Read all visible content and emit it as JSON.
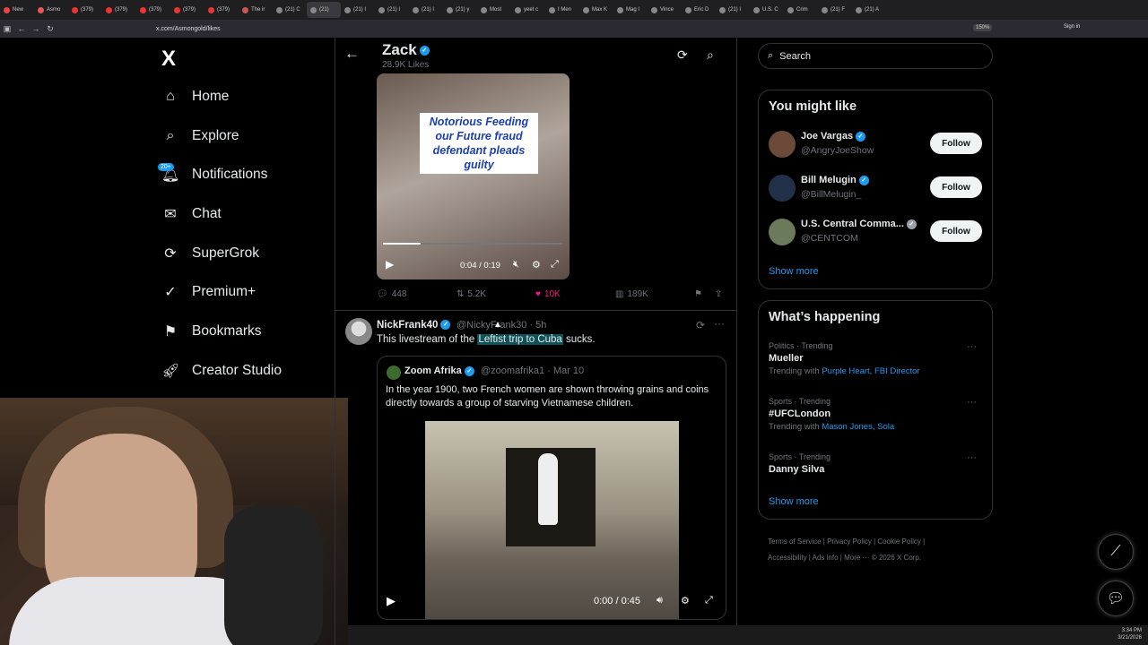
{
  "browser": {
    "tabs": [
      {
        "label": "New",
        "color": "#e44"
      },
      {
        "label": "Asmo",
        "color": "#e55"
      },
      {
        "label": "(379)",
        "color": "#e33"
      },
      {
        "label": "(379)",
        "color": "#e33"
      },
      {
        "label": "(379)",
        "color": "#e33"
      },
      {
        "label": "(379)",
        "color": "#e33"
      },
      {
        "label": "(379)",
        "color": "#e33"
      },
      {
        "label": "The ir",
        "color": "#c55"
      },
      {
        "label": "(21) C",
        "color": "#888"
      },
      {
        "label": "(21)",
        "color": "#888"
      },
      {
        "label": "(21) I",
        "color": "#888"
      },
      {
        "label": "(21) I",
        "color": "#888"
      },
      {
        "label": "(21) I",
        "color": "#888"
      },
      {
        "label": "(21) y",
        "color": "#888"
      },
      {
        "label": "Most",
        "color": "#888"
      },
      {
        "label": "yeet c",
        "color": "#888"
      },
      {
        "label": "I Men",
        "color": "#888"
      },
      {
        "label": "Max K",
        "color": "#888"
      },
      {
        "label": "Mag I",
        "color": "#888"
      },
      {
        "label": "Vince",
        "color": "#888"
      },
      {
        "label": "Eric D",
        "color": "#888"
      },
      {
        "label": "(21) I",
        "color": "#888"
      },
      {
        "label": "U.S. C",
        "color": "#888"
      },
      {
        "label": "Crim",
        "color": "#888"
      },
      {
        "label": "(21) F",
        "color": "#888"
      },
      {
        "label": "(21) A",
        "color": "#888"
      }
    ],
    "url": "x.com/Asmongold/likes",
    "zoom": "150%",
    "sign_in": "Sign in"
  },
  "nav": {
    "logo": "X",
    "items": [
      {
        "label": "Home",
        "icon": "home-icon"
      },
      {
        "label": "Explore",
        "icon": "search-icon"
      },
      {
        "label": "Notifications",
        "icon": "bell-icon",
        "badge": "20+"
      },
      {
        "label": "Chat",
        "icon": "mail-icon"
      },
      {
        "label": "SuperGrok",
        "icon": "grok-icon"
      },
      {
        "label": "Premium+",
        "icon": "verified-icon"
      },
      {
        "label": "Bookmarks",
        "icon": "bookmark-icon"
      },
      {
        "label": "Creator Studio",
        "icon": "rocket-icon"
      }
    ]
  },
  "profile_header": {
    "name": "Zack",
    "subtitle": "28.9K Likes"
  },
  "tweet1": {
    "video_caption": "Notorious Feeding our Future fraud defendant pleads guilty",
    "video_time": "0:04 / 0:19",
    "video_progress": 0.21,
    "replies": "448",
    "reposts": "5.2K",
    "likes": "10K",
    "views": "189K"
  },
  "tweet2": {
    "name": "NickFrank40",
    "handle": "@NickyFrank30 · 5h",
    "text_before": "This livestream of the ",
    "text_highlight": "Leftist trip to Cuba",
    "text_after": " sucks.",
    "quote": {
      "name": "Zoom Afrika",
      "handle": "@zoomafrika1 · Mar 10",
      "text": "In the year 1900, two French women are shown throwing grains and coins directly towards a group of starving Vietnamese children.",
      "video_time": "0:00 / 0:45"
    }
  },
  "sidebar": {
    "search_placeholder": "Search",
    "might_like_title": "You might like",
    "people": [
      {
        "name": "Joe Vargas",
        "handle": "@AngryJoeShow",
        "button": "Follow",
        "color": "#6b4a3a"
      },
      {
        "name": "Bill Melugin",
        "handle": "@BillMelugin_",
        "button": "Follow",
        "color": "#22304a"
      },
      {
        "name": "U.S. Central Comma...",
        "handle": "@CENTCOM",
        "button": "Follow",
        "color": "#6b7a5a"
      }
    ],
    "show_more": "Show more",
    "happening_title": "What’s happening",
    "trends": [
      {
        "category": "Politics · Trending",
        "title": "Mueller",
        "with_label": "Trending with ",
        "with": "Purple Heart, FBI Director"
      },
      {
        "category": "Sports · Trending",
        "title": "#UFCLondon",
        "with_label": "Trending with ",
        "with": "Mason Jones, Sola"
      },
      {
        "category": "Sports · Trending",
        "title": "Danny Silva",
        "with_label": "",
        "with": ""
      }
    ],
    "show_more_2": "Show more",
    "footer_line1": "Terms of Service  |  Privacy Policy  |  Cookie Policy  |",
    "footer_line2": "Accessibility  |  Ads info  |  More ···  © 2026 X Corp."
  },
  "system": {
    "time": "3:34 PM",
    "date": "3/21/2026"
  }
}
